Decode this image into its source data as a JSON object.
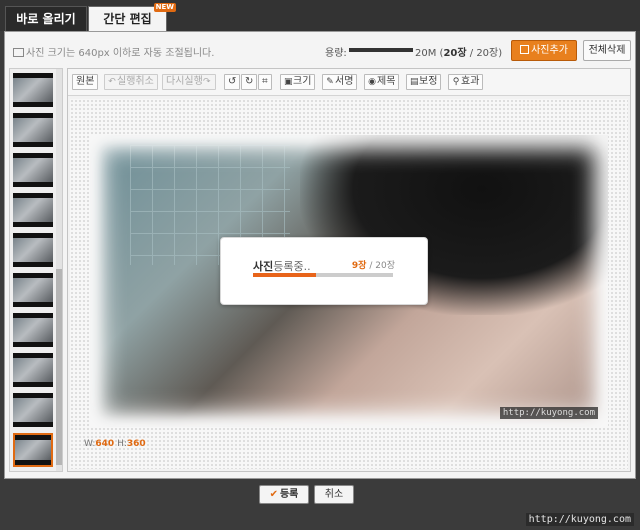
{
  "tabs": {
    "upload": "바로 올리기",
    "edit": "간단 편집",
    "new_badge": "NEW"
  },
  "header": {
    "note": "사진 크기는 640px 이하로 자동 조절됩니다.",
    "capacity_label": "용량:",
    "capacity_used": "20M",
    "capacity_paren_open": "(",
    "capacity_count": "20장",
    "capacity_total": "/ 20장)",
    "add_photo_label": "사진추가",
    "delete_all_label": "전체삭제"
  },
  "toolbar": {
    "original": "원본",
    "undo": "실행취소",
    "redo": "다시실행",
    "rotate_left": "↺",
    "rotate_right": "↻",
    "crop": "⌗",
    "resize": "크기",
    "signature": "서명",
    "title": "제목",
    "correct": "보정",
    "effect": "효과"
  },
  "canvas": {
    "width_label": "W:",
    "width_value": "640",
    "height_label": "H:",
    "height_value": "360",
    "inner_watermark": "http://kuyong.com"
  },
  "progress": {
    "title_bold": "사진",
    "title_rest": "등록중..",
    "current": "9장",
    "separator": "/",
    "total": "20장",
    "fraction": 0.45
  },
  "footer": {
    "register_label": "등록",
    "cancel_label": "취소",
    "site_watermark": "http://kuyong.com"
  },
  "capacity_fraction": 1.0,
  "colors": {
    "accent": "#e8801e",
    "progress": "#e8641a",
    "highlight": "#e06a12"
  }
}
